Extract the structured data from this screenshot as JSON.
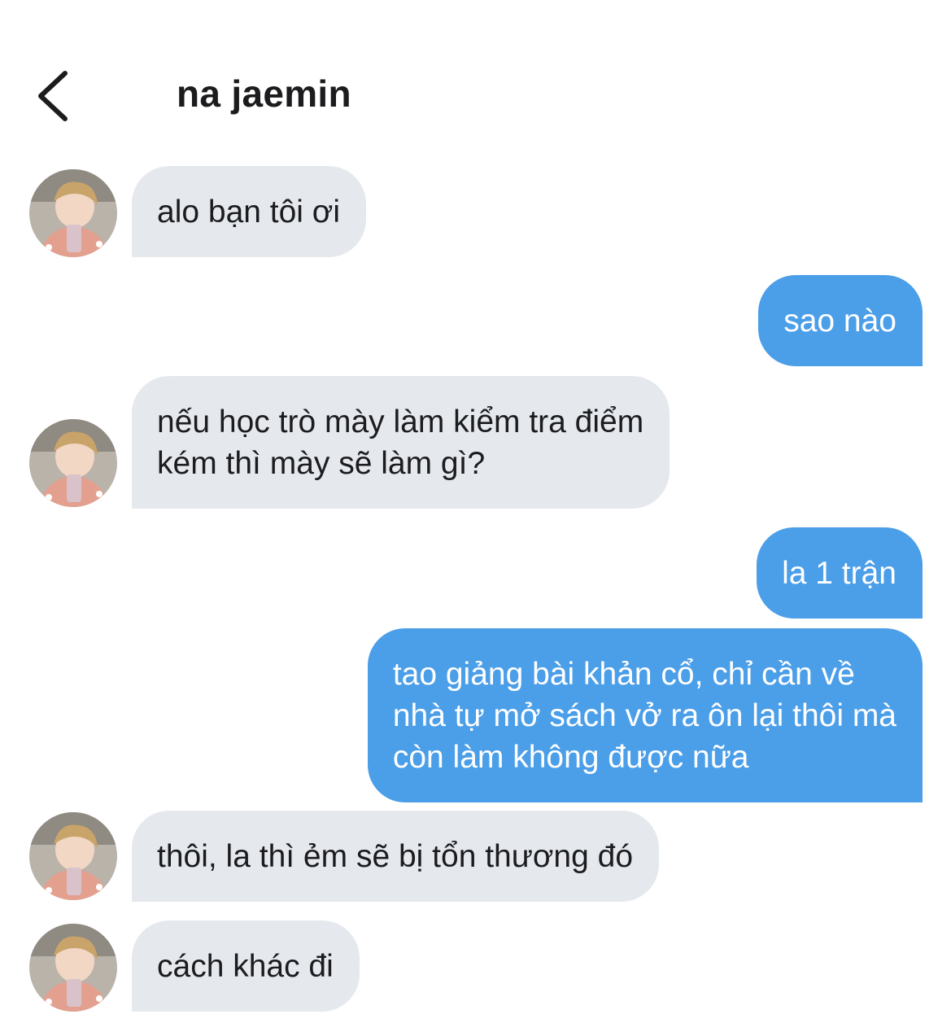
{
  "header": {
    "contact_name": "na jaemin",
    "back_icon": "chevron-left-icon"
  },
  "messages": [
    {
      "direction": "incoming",
      "text": "alo bạn tôi ơi",
      "avatar": true
    },
    {
      "direction": "outgoing",
      "text": "sao nào"
    },
    {
      "direction": "incoming",
      "text": "nếu học trò mày làm kiểm tra điểm\nkém thì mày sẽ làm gì?",
      "avatar": true
    },
    {
      "direction": "outgoing",
      "text": "la 1 trận"
    },
    {
      "direction": "outgoing",
      "text": "tao giảng bài khản cổ, chỉ cần về\nnhà tự mở sách vở ra ôn lại thôi mà\ncòn làm không được nữa"
    },
    {
      "direction": "incoming",
      "text": "thôi, la thì ẻm sẽ bị tổn thương đó",
      "avatar": true
    },
    {
      "direction": "incoming",
      "text": "cách khác đi",
      "avatar": true
    }
  ],
  "colors": {
    "incoming_bubble": "#e5e9ee",
    "outgoing_bubble": "#4b9ee8",
    "text_dark": "#1c1c1e",
    "text_light": "#ffffff"
  }
}
